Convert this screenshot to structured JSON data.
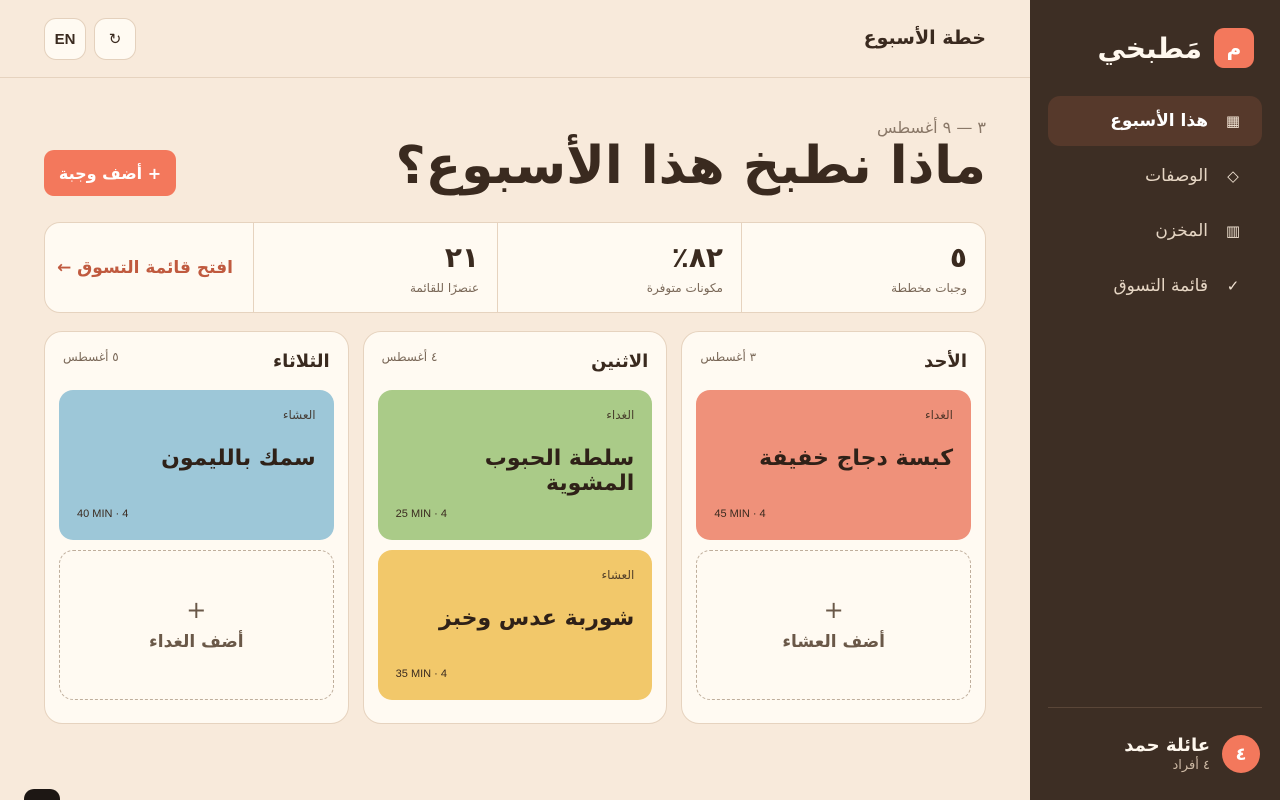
{
  "app": {
    "brand_logo": "م",
    "brand_name": "مَطبخي"
  },
  "sidebar": {
    "items": [
      {
        "label": "هذا الأسبوع",
        "icon": "▦",
        "icon_name": "calendar-grid-icon",
        "active": true
      },
      {
        "label": "الوصفات",
        "icon": "◇",
        "icon_name": "diamond-icon",
        "active": false
      },
      {
        "label": "المخزن",
        "icon": "▥",
        "icon_name": "pantry-icon",
        "active": false
      },
      {
        "label": "قائمة التسوق",
        "icon": "✓",
        "icon_name": "check-icon",
        "active": false
      }
    ],
    "family": {
      "avatar": "٤",
      "name": "عائلة حمد",
      "members": "٤ أفراد"
    }
  },
  "topbar": {
    "title": "خطة الأسبوع",
    "lang_label": "EN",
    "refresh_icon": "↻"
  },
  "header": {
    "date_range": "٣ — ٩ أغسطس",
    "heading": "ماذا نطبخ هذا الأسبوع؟",
    "add_meal_label": "+ أضف وجبة"
  },
  "stats": {
    "items": [
      {
        "value": "٥",
        "label": "وجبات مخططة"
      },
      {
        "value": "٨٢٪",
        "label": "مكونات متوفرة"
      },
      {
        "value": "٢١",
        "label": "عنصرًا للقائمة"
      }
    ],
    "shopping_link": "افتح قائمة التسوق ←"
  },
  "days": [
    {
      "name": "الأحد",
      "date": "٣ أغسطس",
      "meal1": {
        "type": "الغداء",
        "name": "كبسة دجاج خفيفة",
        "meta": "45 MIN · 4"
      },
      "add_label": "أضف العشاء"
    },
    {
      "name": "الاثنين",
      "date": "٤ أغسطس",
      "meal1": {
        "type": "الغداء",
        "name": "سلطة الحبوب المشوية",
        "meta": "25 MIN · 4"
      },
      "meal2": {
        "type": "العشاء",
        "name": "شوربة عدس وخبز",
        "meta": "35 MIN · 4"
      }
    },
    {
      "name": "الثلاثاء",
      "date": "٥ أغسطس",
      "meal1": {
        "type": "العشاء",
        "name": "سمك بالليمون",
        "meta": "40 MIN · 4"
      },
      "add_label": "أضف الغداء"
    }
  ],
  "add_plus": "+",
  "colors": {
    "accent": "#f3785c",
    "sidebar_bg": "#3d2e24",
    "page_bg": "#f8eadb",
    "meal_red": "#ef917a",
    "meal_green": "#aacb88",
    "meal_yellow": "#f2c86a",
    "meal_blue": "#9dc7d8"
  }
}
